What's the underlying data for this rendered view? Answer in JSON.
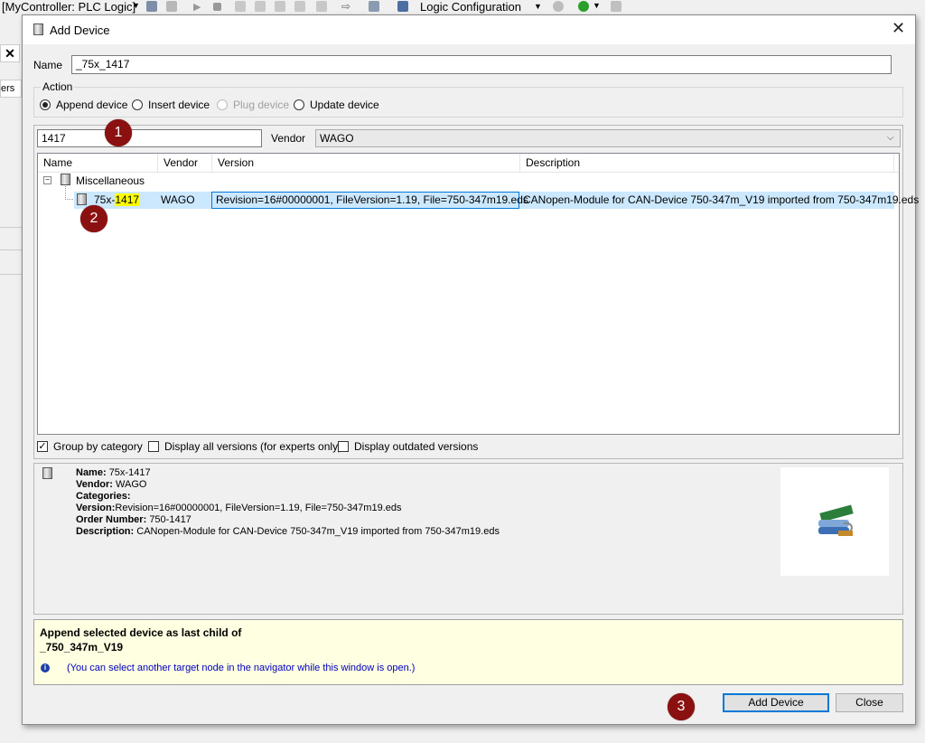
{
  "app": {
    "title_fragment": "[MyController: PLC Logic]",
    "config_dropdown": "Logic Configuration",
    "left_tab_fragment": "ers"
  },
  "dialog": {
    "title": "Add Device",
    "name_label": "Name",
    "name_value": "_75x_1417",
    "action": {
      "group_label": "Action",
      "options": [
        "Append device",
        "Insert device",
        "Plug device",
        "Update device"
      ]
    },
    "search_value": "1417",
    "vendor_label": "Vendor",
    "vendor_value": "WAGO",
    "table": {
      "columns": [
        "Name",
        "Vendor",
        "Version",
        "Description"
      ],
      "category": "Miscellaneous",
      "row": {
        "name_prefix": "75x-",
        "name_highlight": "1417",
        "vendor": "WAGO",
        "version": "Revision=16#00000001, FileVersion=1.19, File=750-347m19.eds",
        "description": "CANopen-Module for CAN-Device 750-347m_V19 imported from 750-347m19.eds"
      }
    },
    "options": {
      "group_by_category": "Group by category",
      "display_all_versions": "Display all versions (for experts only)",
      "display_outdated": "Display outdated versions"
    },
    "details": {
      "name_key": "Name:",
      "name_val": "75x-1417",
      "vendor_key": "Vendor:",
      "vendor_val": "WAGO",
      "categories_key": "Categories:",
      "version_key": "Version:",
      "version_val": "Revision=16#00000001, FileVersion=1.19, File=750-347m19.eds",
      "order_key": "Order Number:",
      "order_val": "750-1417",
      "desc_key": "Description:",
      "desc_val": "CANopen-Module for CAN-Device 750-347m_V19 imported from 750-347m19.eds"
    },
    "hint": {
      "line1": "Append selected device as last child of",
      "line2": "_750_347m_V19",
      "info": "(You can select another target node in the navigator while this window is open.)"
    },
    "buttons": {
      "add": "Add Device",
      "close": "Close"
    }
  },
  "markers": [
    "1",
    "2",
    "3"
  ],
  "colors": {
    "selection": "#cce8ff",
    "highlight": "#ffff00",
    "marker": "#8b1111",
    "hint_bg": "#ffffe1",
    "info_text": "#0000c0",
    "default_button": "#0078d7"
  }
}
